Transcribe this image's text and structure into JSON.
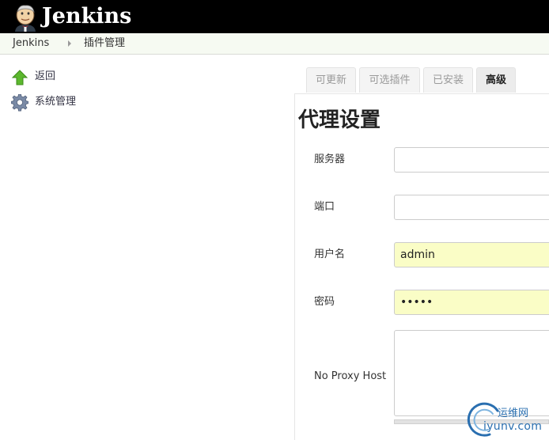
{
  "header": {
    "logo_text": "Jenkins"
  },
  "breadcrumb": {
    "items": [
      "Jenkins",
      "插件管理"
    ]
  },
  "sidebar": {
    "items": [
      {
        "label": "返回",
        "icon": "up-arrow-icon"
      },
      {
        "label": "系统管理",
        "icon": "gear-icon"
      }
    ]
  },
  "tabs": [
    {
      "label": "可更新",
      "active": false
    },
    {
      "label": "可选插件",
      "active": false
    },
    {
      "label": "已安装",
      "active": false
    },
    {
      "label": "高级",
      "active": true
    }
  ],
  "proxy": {
    "title": "代理设置",
    "server_label": "服务器",
    "server_value": "",
    "port_label": "端口",
    "port_value": "",
    "username_label": "用户名",
    "username_value": "admin",
    "password_label": "密码",
    "password_value": "•••••",
    "no_proxy_label": "No Proxy Host",
    "no_proxy_value": ""
  },
  "watermark": {
    "top": "运维网",
    "bottom": "iyunv.com"
  },
  "colors": {
    "header_bg": "#000000",
    "breadcrumb_bg": "#f6faf2",
    "autofill_bg": "#fafdc6",
    "active_tab_bg": "#ececec",
    "watermark": "#2a6fb0"
  }
}
